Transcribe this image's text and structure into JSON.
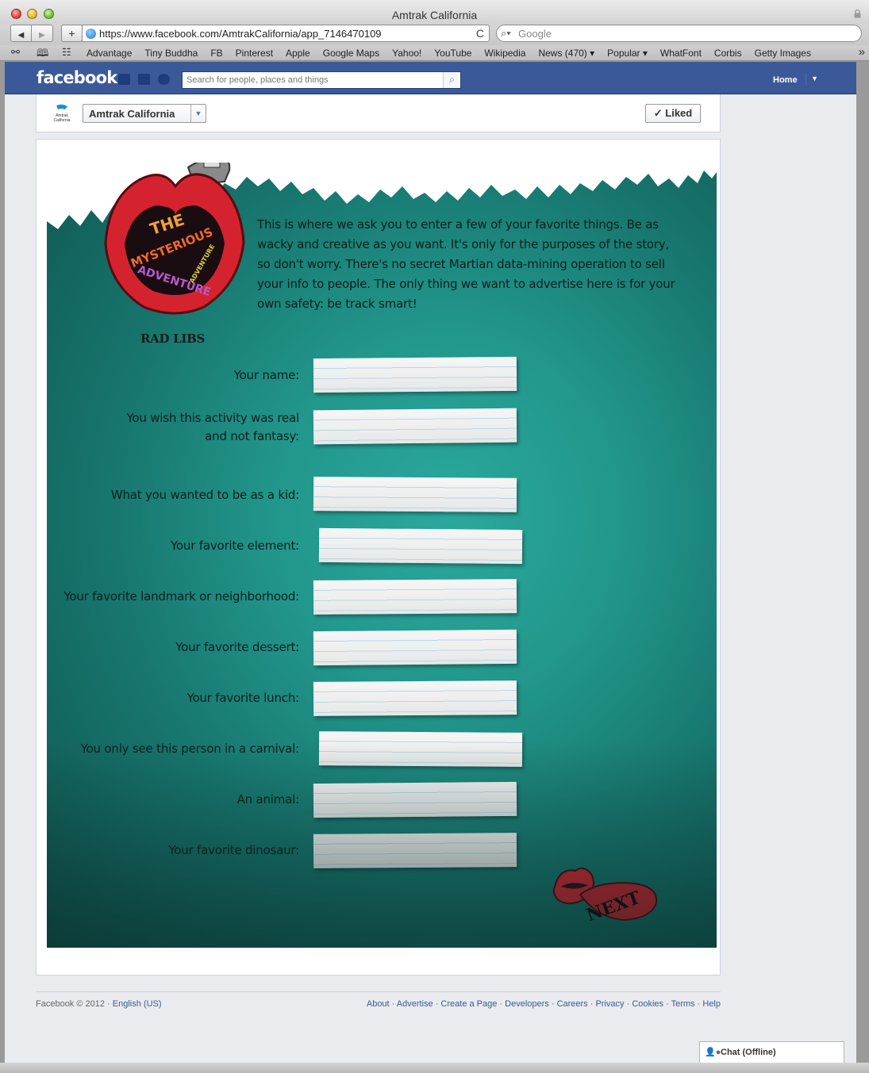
{
  "window": {
    "title": "Amtrak California"
  },
  "toolbar": {
    "back": "◀",
    "forward": "▶",
    "add": "+",
    "url": "https://www.facebook.com/AmtrakCalifornia/app_7146470109",
    "reload": "C",
    "search_placeholder": "Google"
  },
  "bookmarks": [
    "Advantage",
    "Tiny Buddha",
    "FB",
    "Pinterest",
    "Apple",
    "Google Maps",
    "Yahoo!",
    "YouTube",
    "Wikipedia",
    "News (470) ▾",
    "Popular ▾",
    "WhatFont",
    "Corbis",
    "Getty Images"
  ],
  "facebook": {
    "logo": "facebook",
    "search_placeholder": "Search for people, places and things",
    "home": "Home"
  },
  "page": {
    "name": "Amtrak California",
    "liked": "✓ Liked",
    "avatar_text": "Amtrak California"
  },
  "app": {
    "logo_words": [
      "THE",
      "MYSTERIOUS",
      "ADVENTURE",
      "ADVENTURE"
    ],
    "rad_libs": "RAD LIBS",
    "intro": "This is where we ask you to enter a few of your favorite things. Be as wacky and creative as you want. It's only for the purposes of the story, so don't worry. There's no secret Martian data-mining operation to sell your info to people. The only thing we want to advertise here is for your own safety: be track smart!",
    "fields": [
      {
        "label": "Your name:",
        "value": ""
      },
      {
        "label": "You wish this activity was real and not fantasy:",
        "value": ""
      },
      {
        "label": "What you wanted to be as a kid:",
        "value": ""
      },
      {
        "label": "Your favorite element:",
        "value": ""
      },
      {
        "label": "Your favorite landmark or neighborhood:",
        "value": ""
      },
      {
        "label": "Your favorite dessert:",
        "value": ""
      },
      {
        "label": "Your favorite lunch:",
        "value": ""
      },
      {
        "label": "You only see this person in a carnival:",
        "value": ""
      },
      {
        "label": "An animal:",
        "value": ""
      },
      {
        "label": "Your favorite dinosaur:",
        "value": ""
      }
    ],
    "next": "NEXT"
  },
  "footer": {
    "copyright": "Facebook © 2012 · ",
    "language": "English (US)",
    "links": [
      "About",
      "Advertise",
      "Create a Page",
      "Developers",
      "Careers",
      "Privacy",
      "Cookies",
      "Terms",
      "Help"
    ]
  },
  "chat": {
    "label": "Chat (Offline)"
  },
  "colors": {
    "fb_blue": "#3b5998",
    "teal": "#1f8f85",
    "lips_red": "#d4232f"
  }
}
